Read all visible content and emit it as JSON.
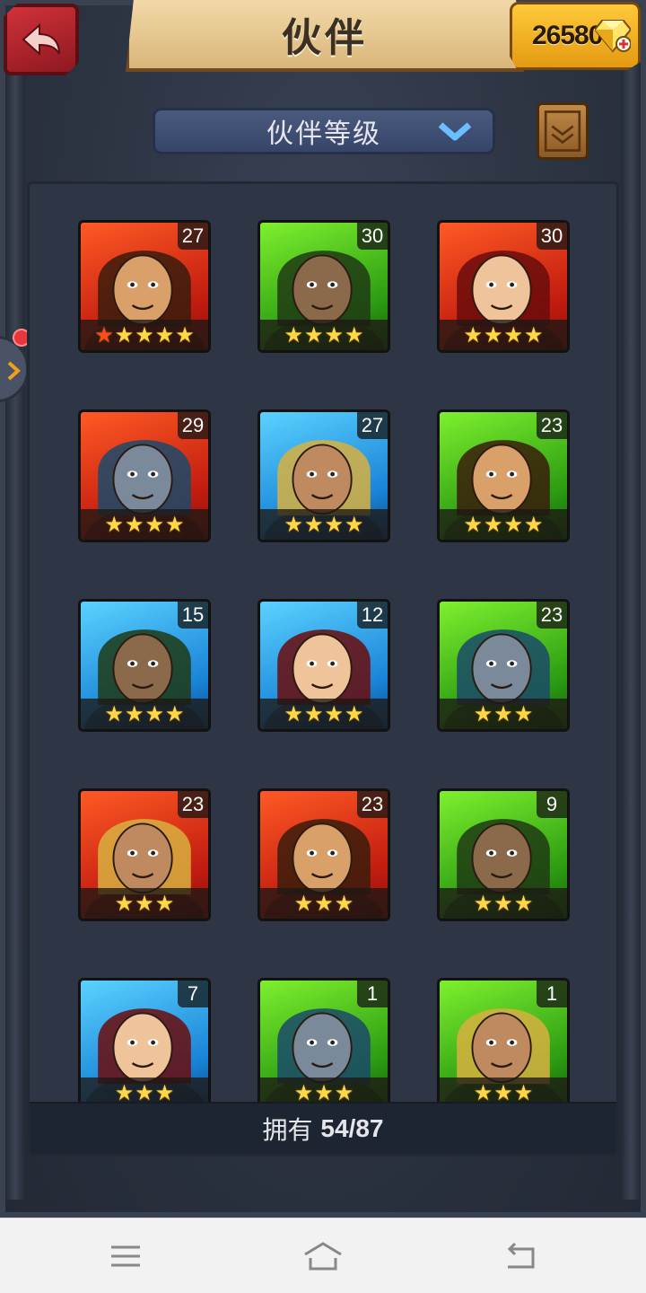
{
  "header": {
    "title": "伙伴",
    "gems": "26580"
  },
  "sort": {
    "label": "伙伴等级"
  },
  "colors": {
    "red": "#c21c10",
    "green": "#2c9c12",
    "blue": "#1a84d8",
    "star": "#ffd84a",
    "red_star": "#ff4a1a"
  },
  "heroes": [
    {
      "level": "27",
      "stars": 5,
      "red_stars": 1,
      "color": "red"
    },
    {
      "level": "30",
      "stars": 4,
      "red_stars": 0,
      "color": "green"
    },
    {
      "level": "30",
      "stars": 4,
      "red_stars": 0,
      "color": "red"
    },
    {
      "level": "29",
      "stars": 4,
      "red_stars": 0,
      "color": "red"
    },
    {
      "level": "27",
      "stars": 4,
      "red_stars": 0,
      "color": "blue"
    },
    {
      "level": "23",
      "stars": 4,
      "red_stars": 0,
      "color": "green"
    },
    {
      "level": "15",
      "stars": 4,
      "red_stars": 0,
      "color": "blue"
    },
    {
      "level": "12",
      "stars": 4,
      "red_stars": 0,
      "color": "blue"
    },
    {
      "level": "23",
      "stars": 3,
      "red_stars": 0,
      "color": "green"
    },
    {
      "level": "23",
      "stars": 3,
      "red_stars": 0,
      "color": "red"
    },
    {
      "level": "23",
      "stars": 3,
      "red_stars": 0,
      "color": "red"
    },
    {
      "level": "9",
      "stars": 3,
      "red_stars": 0,
      "color": "green"
    },
    {
      "level": "7",
      "stars": 3,
      "red_stars": 0,
      "color": "blue"
    },
    {
      "level": "1",
      "stars": 3,
      "red_stars": 0,
      "color": "green"
    },
    {
      "level": "1",
      "stars": 3,
      "red_stars": 0,
      "color": "green"
    }
  ],
  "footer": {
    "owned_label": "拥有",
    "owned_count": "54/87"
  },
  "icons": {
    "back": "back-arrow-icon",
    "gem": "diamond-icon",
    "dropdown": "chevron-down-icon",
    "book": "book-icon",
    "nav_menu": "menu-icon",
    "nav_home": "home-icon",
    "nav_back": "back-icon"
  }
}
